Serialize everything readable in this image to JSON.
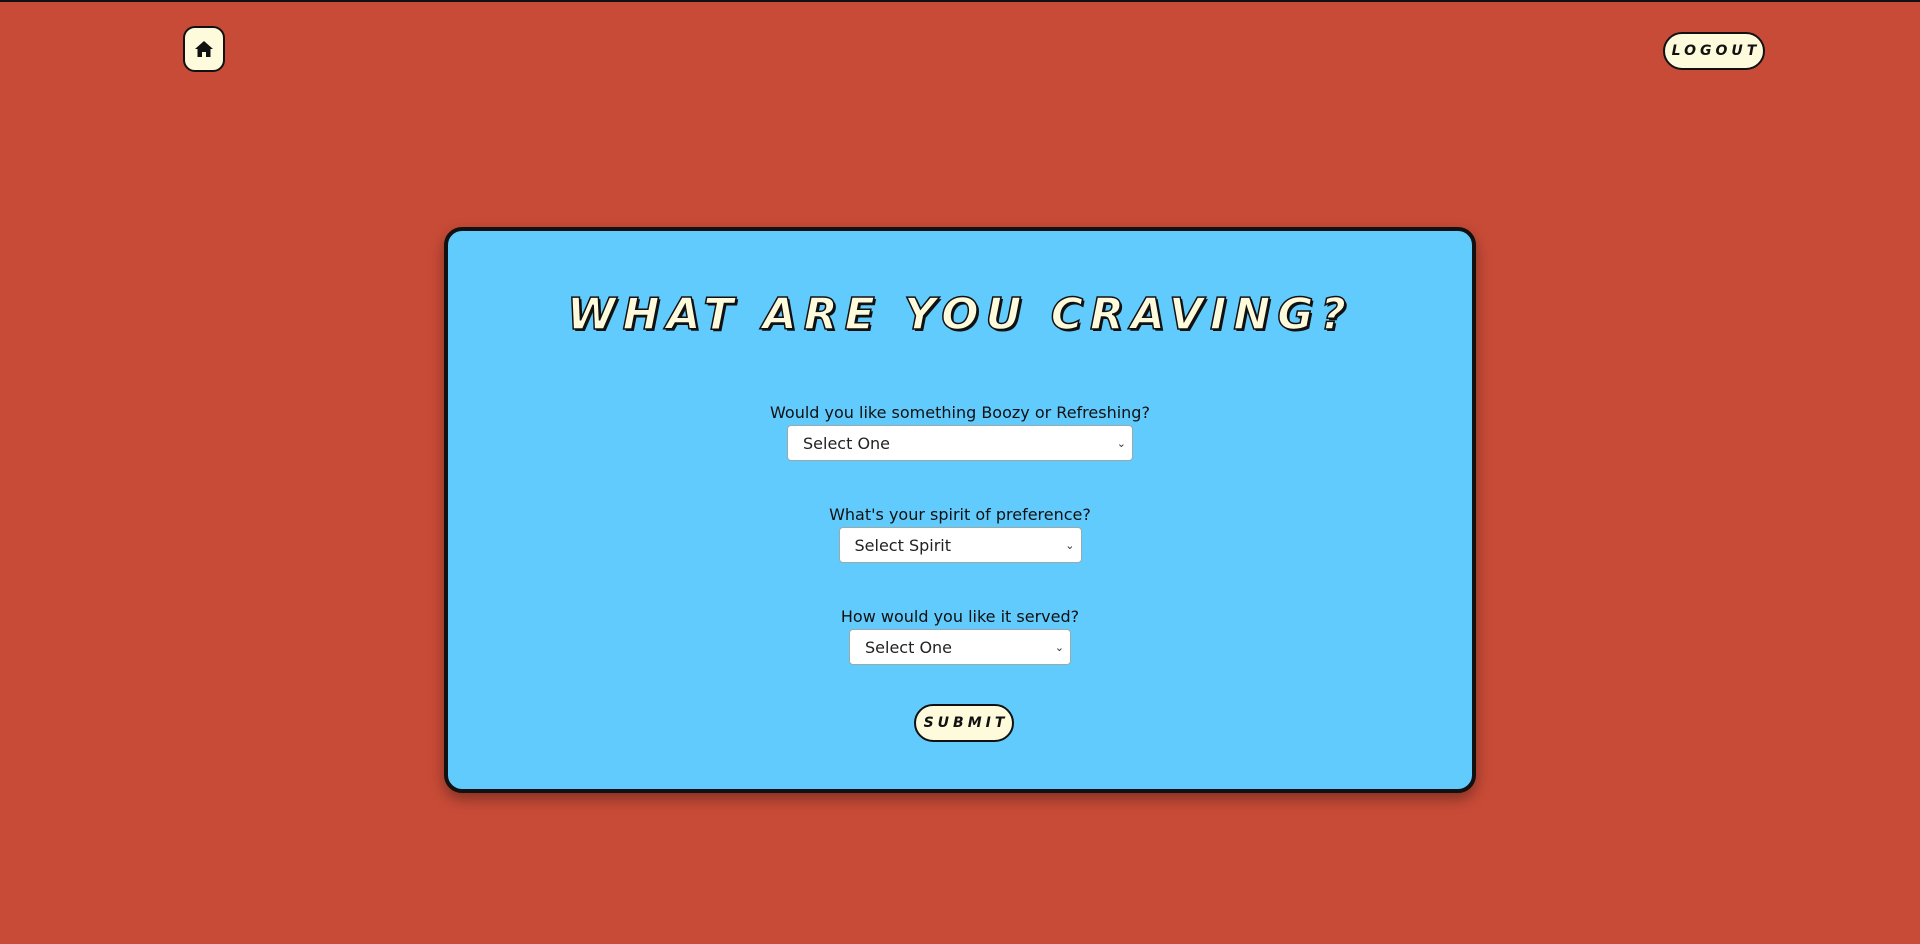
{
  "nav": {
    "home_icon": "home-icon",
    "logout_label": "LOGOUT"
  },
  "card": {
    "title": "What are you craving?",
    "fields": [
      {
        "label": "Would you like something Boozy or Refreshing?",
        "selected": "Select One"
      },
      {
        "label": "What's your spirit of preference?",
        "selected": "Select Spirit"
      },
      {
        "label": "How would you like it served?",
        "selected": "Select One"
      }
    ],
    "submit_label": "SUBMIT"
  },
  "colors": {
    "background": "#c84b37",
    "card": "#62cbfd",
    "button": "#fdfbdc",
    "border": "#111111"
  }
}
